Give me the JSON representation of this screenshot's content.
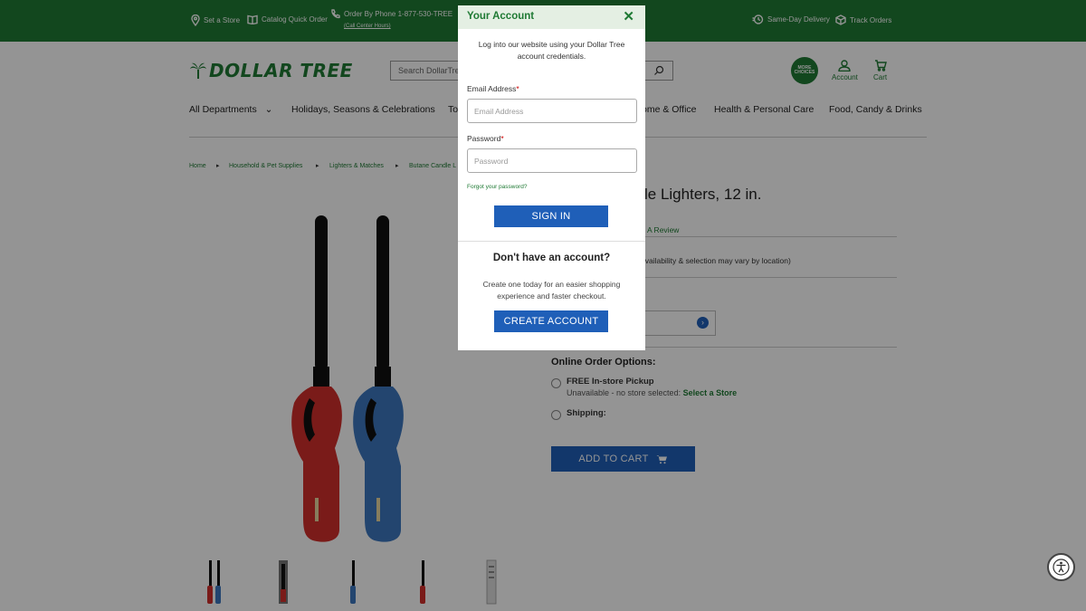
{
  "topbar": {
    "set_store": "Set a Store",
    "catalog": "Catalog Quick Order",
    "phone": "Order By Phone 1-877-530-TREE",
    "call_hours": "(Call Center Hours)",
    "same_day": "Same-Day Delivery",
    "track": "Track Orders"
  },
  "header": {
    "logo_text": "DOLLAR TREE",
    "search_placeholder": "Search DollarTree",
    "more_badge_line1": "MORE",
    "more_badge_line2": "CHOICES",
    "account_label": "Account",
    "cart_label": "Cart"
  },
  "nav": {
    "items": [
      "All Departments",
      "Holidays, Seasons & Celebrations",
      "To",
      "ome & Office",
      "Health & Personal Care",
      "Food, Candy & Drinks"
    ]
  },
  "breadcrumb": {
    "items": [
      "Home",
      "Household & Pet Supplies",
      "Lighters & Matches",
      "Butane Candle L"
    ]
  },
  "product": {
    "title_fragment": "le Lighters, 12 in.",
    "review_link": "A Review",
    "availability_note": "availability & selection may vary by location)",
    "online_order_title": "Online Order Options:",
    "pickup_label": "FREE In-store Pickup",
    "pickup_sub": "Unavailable - no store selected:",
    "select_store": "Select a Store",
    "shipping_label": "Shipping:",
    "add_to_cart": "ADD TO CART"
  },
  "modal": {
    "title": "Your Account",
    "intro": "Log into our website using your Dollar Tree account credentials.",
    "email_label": "Email Address",
    "email_placeholder": "Email Address",
    "password_label": "Password",
    "password_placeholder": "Password",
    "required_mark": "*",
    "forgot": "Forgot your password?",
    "sign_in": "SIGN IN",
    "no_account": "Don't have an account?",
    "create_sub": "Create one today for an easier shopping experience and faster checkout.",
    "create_account": "CREATE ACCOUNT",
    "close_glyph": "✕"
  },
  "colors": {
    "brand_green": "#1f7a34",
    "button_blue": "#1f5fb8",
    "lighter_red": "#d3302b",
    "lighter_blue": "#3d78bf"
  }
}
